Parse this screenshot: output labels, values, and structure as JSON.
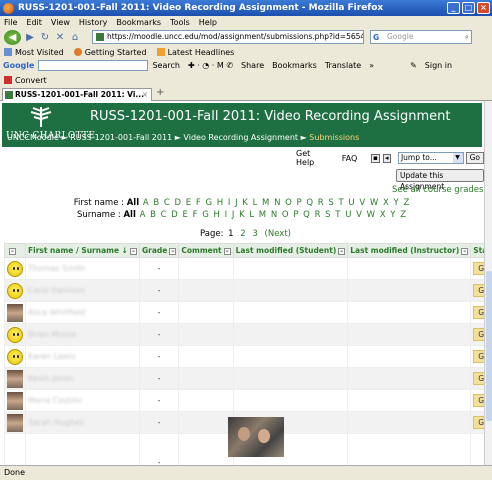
{
  "window": {
    "title": "RUSS-1201-001-Fall 2011: Video Recording Assignment - Mozilla Firefox",
    "controls": [
      "_",
      "□",
      "×"
    ]
  },
  "menu": [
    "File",
    "Edit",
    "View",
    "History",
    "Bookmarks",
    "Tools",
    "Help"
  ],
  "nav": {
    "url": "https://moodle.uncc.edu/mod/assignment/submissions.php?id=565476",
    "search_placeholder": "Google"
  },
  "bookmarks": [
    "Most Visited",
    "Getting Started",
    "Latest Headlines"
  ],
  "gtoolbar": {
    "logo": "Google",
    "items": [
      "Search",
      "Share",
      "Bookmarks",
      "Translate",
      "»",
      "Sign in"
    ]
  },
  "convert": "Convert",
  "tab": {
    "label": "RUSS-1201-001-Fall 2011: Vi..."
  },
  "header": {
    "logo": "UNC CHARLOTTE",
    "title": "RUSS-1201-001-Fall 2011: Video Recording Assignment",
    "breadcrumb": [
      "UNCCMoodle",
      "RUSS-1201-001-Fall 2011",
      "Video Recording Assignment",
      "Submissions"
    ],
    "sep": "►"
  },
  "tools": {
    "help": "Get Help",
    "faq": "FAQ",
    "jump": "Jump to...",
    "go": "Go"
  },
  "update_button": "Update this Assignment",
  "all_grades": "See all course grades",
  "filter": {
    "first_label": "First name :",
    "surname_label": "Surname :",
    "all": "All",
    "letters": [
      "A",
      "B",
      "C",
      "D",
      "E",
      "F",
      "G",
      "H",
      "I",
      "J",
      "K",
      "L",
      "M",
      "N",
      "O",
      "P",
      "Q",
      "R",
      "S",
      "T",
      "U",
      "V",
      "W",
      "X",
      "Y",
      "Z"
    ]
  },
  "pager": {
    "label": "Page:",
    "current": "1",
    "pages": [
      "2",
      "3"
    ],
    "next": "(Next)"
  },
  "table": {
    "headers": [
      "First name / Surname ↓",
      "Grade",
      "Comment",
      "Last modified (Student)",
      "Last modified (Instructor)",
      "Status",
      "Fi"
    ],
    "rows": [
      {
        "name": "Thomas Smith",
        "grade": "-",
        "status": "Grade",
        "avatar": "smiley"
      },
      {
        "name": "Carol Harrison",
        "grade": "-",
        "status": "Grade",
        "avatar": "smiley"
      },
      {
        "name": "Alice Whitfield",
        "grade": "-",
        "status": "Grade",
        "avatar": "photo"
      },
      {
        "name": "Brian Moore",
        "grade": "-",
        "status": "Grade",
        "avatar": "smiley"
      },
      {
        "name": "Karen Lewis",
        "grade": "-",
        "status": "Grade",
        "avatar": "smiley"
      },
      {
        "name": "Kevin Jones",
        "grade": "-",
        "status": "Grade",
        "avatar": "photo"
      },
      {
        "name": "Maria Castillo",
        "grade": "-",
        "status": "Grade",
        "avatar": "photo"
      },
      {
        "name": "Sarah Hughes",
        "grade": "-",
        "status": "Grade",
        "avatar": "photo"
      },
      {
        "name": "Kate Dawson",
        "grade": "-",
        "status": "",
        "avatar": "photo"
      }
    ]
  },
  "status": "Done"
}
